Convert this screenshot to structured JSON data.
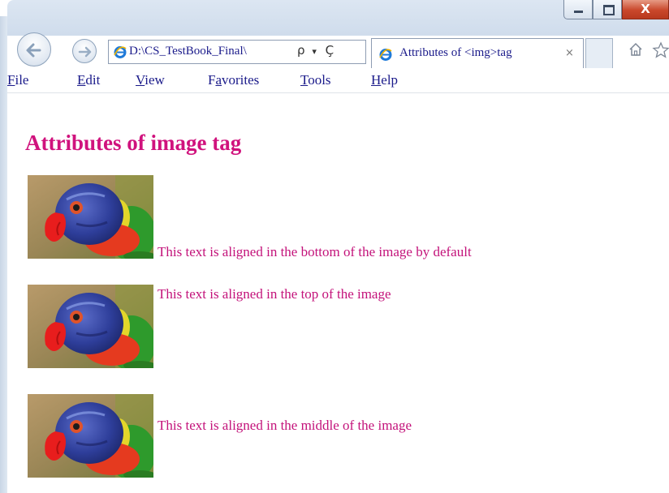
{
  "window": {
    "controls": {
      "minimize_icon": "minimize-icon",
      "maximize_icon": "maximize-icon",
      "close_label": "X"
    }
  },
  "toolbar": {
    "address": "D:\\CS_TestBook_Final\\",
    "search_glyph": "ρ",
    "dropdown_glyph": "▾",
    "refresh_glyph": "Ç",
    "tab_title": "Attributes of <img>tag",
    "tab_close": "×"
  },
  "menu": {
    "file": {
      "key": "F",
      "rest": "ile"
    },
    "edit": {
      "key": "E",
      "rest": "dit"
    },
    "view": {
      "key": "V",
      "rest": "iew"
    },
    "favorites": {
      "pre": "F",
      "key": "a",
      "rest": "vorites"
    },
    "tools": {
      "key": "T",
      "rest": "ools"
    },
    "help": {
      "key": "H",
      "rest": "elp"
    }
  },
  "page": {
    "heading": "Attributes of image tag",
    "text_bottom": "This text is aligned in the bottom of the image by default",
    "text_top": "This text is aligned in the top of the image",
    "text_middle": "This text is aligned in the middle of the image"
  },
  "colors": {
    "heading": "#d0127d",
    "body_text": "#c3127a",
    "menu_text": "#1a1a8a"
  },
  "icons": {
    "back": "back-arrow-icon",
    "forward": "forward-arrow-icon",
    "ie": "ie-logo-icon",
    "home": "home-icon",
    "favorites": "star-icon",
    "image": "parrot-image"
  }
}
